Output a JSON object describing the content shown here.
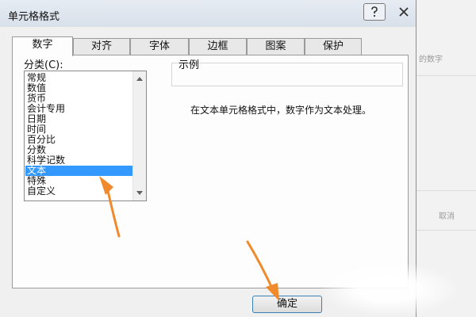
{
  "dialog": {
    "title": "单元格格式",
    "help_icon": "help-icon",
    "close_icon": "close-icon"
  },
  "tabs": [
    {
      "label": "数字",
      "active": true
    },
    {
      "label": "对齐",
      "active": false
    },
    {
      "label": "字体",
      "active": false
    },
    {
      "label": "边框",
      "active": false
    },
    {
      "label": "图案",
      "active": false
    },
    {
      "label": "保护",
      "active": false
    }
  ],
  "category": {
    "label": "分类(C):",
    "items": [
      "常规",
      "数值",
      "货币",
      "会计专用",
      "日期",
      "时间",
      "百分比",
      "分数",
      "科学记数",
      "文本",
      "特殊",
      "自定义"
    ],
    "selected_index": 9
  },
  "sample": {
    "label": "示例",
    "value": ""
  },
  "description": "在文本单元格格式中，数字作为文本处理。",
  "buttons": {
    "ok": "确定"
  },
  "background": {
    "right_text_1": "的数字",
    "right_text_2": "取消"
  },
  "colors": {
    "selection": "#3399ff",
    "arrow": "#f08a2c"
  }
}
